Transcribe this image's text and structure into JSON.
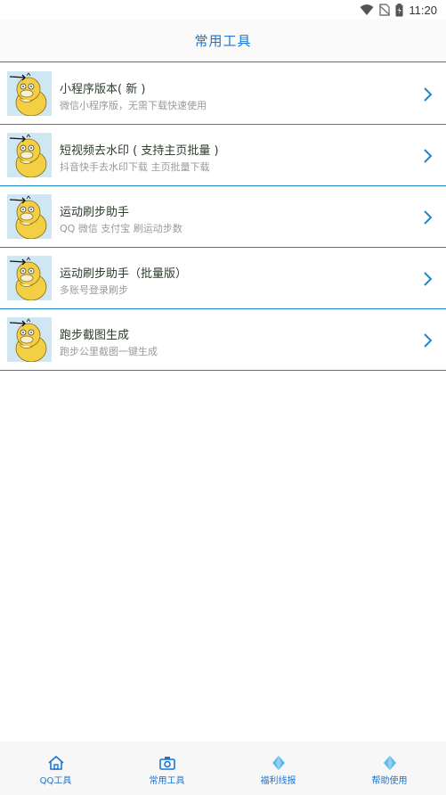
{
  "status": {
    "time": "11:20"
  },
  "header": {
    "title": "常用工具"
  },
  "tools": [
    {
      "title": "小程序版本( 新 )",
      "subtitle": "微信小程序版，无需下载快速使用"
    },
    {
      "title": "短视频去水印 ( 支持主页批量 )",
      "subtitle": "抖音快手去水印下载 主页批量下载"
    },
    {
      "title": "运动刷步助手",
      "subtitle": "QQ 微信 支付宝 刷运动步数"
    },
    {
      "title": "运动刷步助手（批量版）",
      "subtitle": "多账号登录刷步"
    },
    {
      "title": "跑步截图生成",
      "subtitle": "跑步公里截图一键生成"
    }
  ],
  "tabs": [
    {
      "label": "QQ工具",
      "icon": "home-icon"
    },
    {
      "label": "常用工具",
      "icon": "camera-icon"
    },
    {
      "label": "福利线报",
      "icon": "gem-icon"
    },
    {
      "label": "帮助使用",
      "icon": "gem-icon"
    }
  ],
  "colors": {
    "accent": "#1976d2",
    "divider": "#1e88c8",
    "thumb_bg": "#cfe6f3",
    "psyduck": "#f2cf45"
  }
}
